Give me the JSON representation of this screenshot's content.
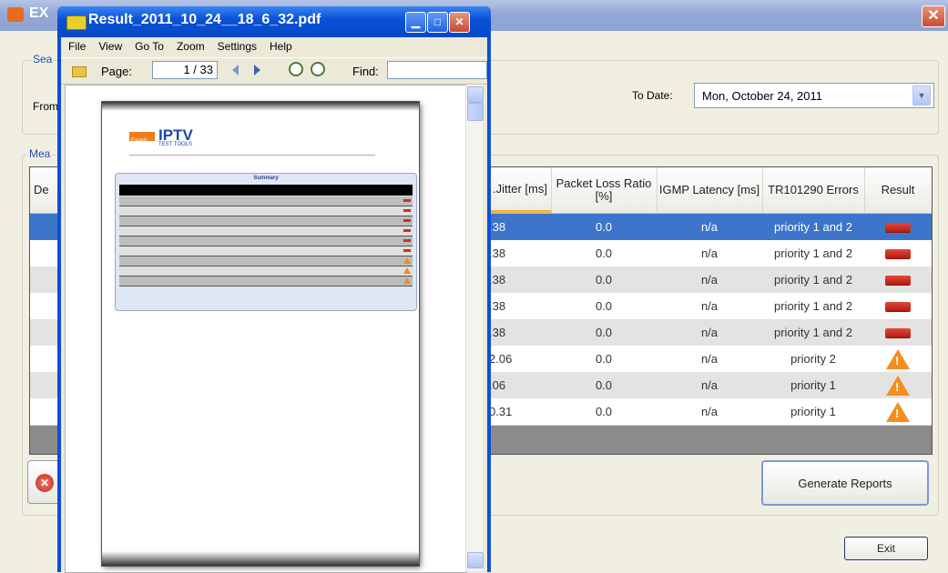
{
  "main_window": {
    "title": "EX",
    "search_group_label": "Sea",
    "from_label": "From",
    "to_date_label": "To Date:",
    "to_date_value": "Mon,  October  24, 2011",
    "measurements_group_label": "Mea",
    "first_column_header_fragment": "De",
    "generate_reports_label": "Generate Reports",
    "exit_label": "Exit"
  },
  "grid": {
    "columns": [
      {
        "label": ".Jitter [ms]"
      },
      {
        "label": "Packet Loss Ratio [%]"
      },
      {
        "label": "IGMP Latency [ms]"
      },
      {
        "label": "TR101290 Errors"
      },
      {
        "label": "Result"
      }
    ],
    "rows": [
      {
        "jitter": ".38",
        "loss": "0.0",
        "igmp": "n/a",
        "errors": "priority 1 and 2",
        "result": "error",
        "selected": true
      },
      {
        "jitter": ".38",
        "loss": "0.0",
        "igmp": "n/a",
        "errors": "priority 1 and 2",
        "result": "error"
      },
      {
        "jitter": ".38",
        "loss": "0.0",
        "igmp": "n/a",
        "errors": "priority 1 and 2",
        "result": "error"
      },
      {
        "jitter": ".38",
        "loss": "0.0",
        "igmp": "n/a",
        "errors": "priority 1 and 2",
        "result": "error"
      },
      {
        "jitter": ".38",
        "loss": "0.0",
        "igmp": "n/a",
        "errors": "priority 1 and 2",
        "result": "error"
      },
      {
        "jitter": "2.06",
        "loss": "0.0",
        "igmp": "n/a",
        "errors": "priority 2",
        "result": "warning"
      },
      {
        "jitter": ".06",
        "loss": "0.0",
        "igmp": "n/a",
        "errors": "priority 1",
        "result": "warning"
      },
      {
        "jitter": "0.31",
        "loss": "0.0",
        "igmp": "n/a",
        "errors": "priority 1",
        "result": "warning"
      }
    ]
  },
  "pdf_window": {
    "title": "Result_2011_10_24__18_6_32.pdf",
    "menu": [
      "File",
      "View",
      "Go To",
      "Zoom",
      "Settings",
      "Help"
    ],
    "page_label": "Page:",
    "page_value": "1 / 33",
    "find_label": "Find:",
    "logo_badge": "Expert",
    "logo_text": "IPTV",
    "logo_subtext": "TEST TOOLS",
    "summary_title": "Summary",
    "summary_rows": [
      "error",
      "error",
      "error",
      "error",
      "error",
      "error",
      "warning",
      "warning",
      "warning"
    ]
  },
  "colors": {
    "selected_row": "#3c75c9",
    "error_mark": "#c83220",
    "warning_mark": "#f28f1f",
    "xp_blue": "#0a52d9"
  },
  "icons": {
    "error": "red-bar-icon",
    "warning": "warning-triangle-icon"
  }
}
